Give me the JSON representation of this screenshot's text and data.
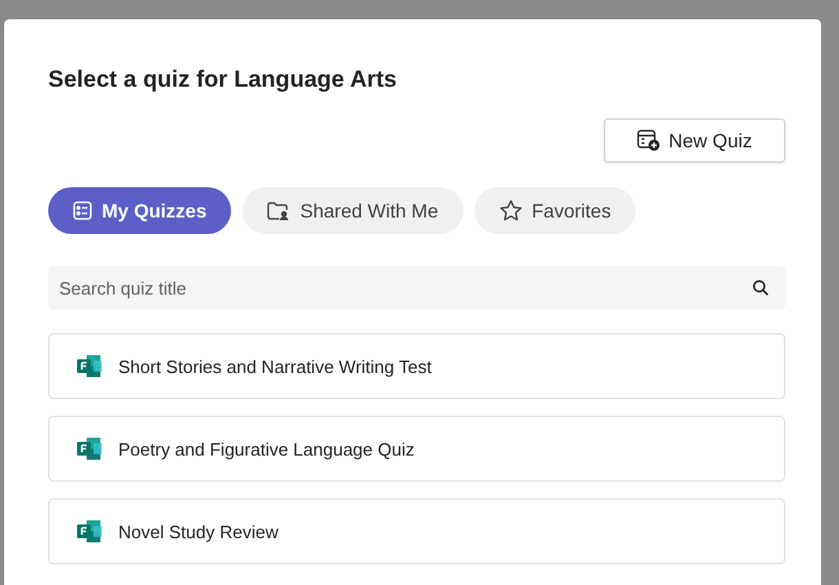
{
  "dialog": {
    "title": "Select a quiz for Language Arts"
  },
  "new_quiz_button": {
    "label": "New Quiz"
  },
  "tabs": [
    {
      "label": "My Quizzes",
      "selected": true,
      "kind": "list"
    },
    {
      "label": "Shared With Me",
      "selected": false,
      "kind": "shared"
    },
    {
      "label": "Favorites",
      "selected": false,
      "kind": "star"
    }
  ],
  "search": {
    "placeholder": "Search quiz title"
  },
  "quizzes": [
    {
      "title": "Short Stories and Narrative Writing Test"
    },
    {
      "title": "Poetry and Figurative Language Quiz"
    },
    {
      "title": "Novel Study Review"
    }
  ]
}
